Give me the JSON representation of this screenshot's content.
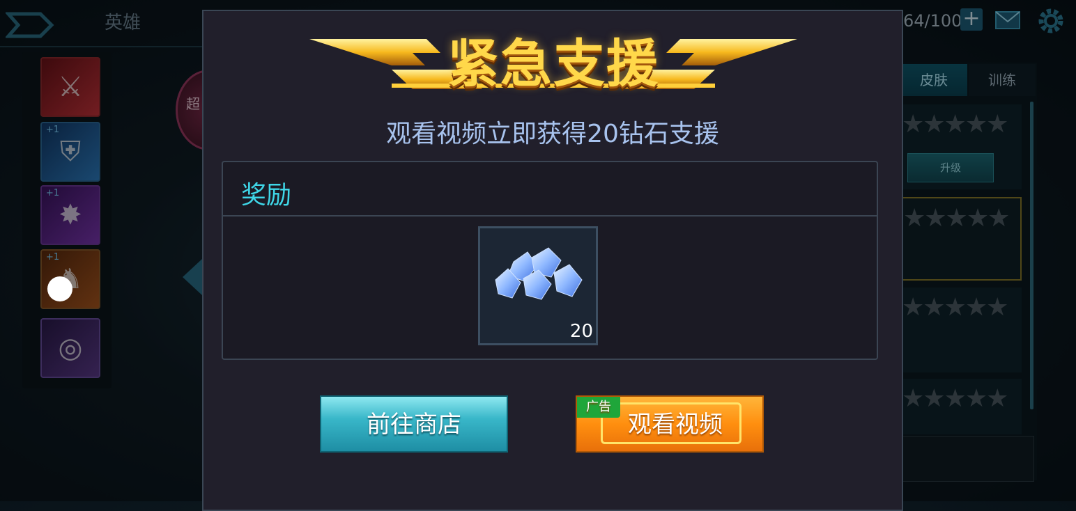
{
  "background": {
    "top_title": "英雄",
    "resource_count": "64/100",
    "add_label": "+",
    "pink_badge_text": "超",
    "equipment_slots": [
      {
        "badge": ""
      },
      {
        "badge": "+1"
      },
      {
        "badge": "+1"
      },
      {
        "badge": "+1"
      },
      {
        "badge": ""
      }
    ],
    "tabs": {
      "skin": "皮肤",
      "train": "训练"
    },
    "upgrade_label": "升级"
  },
  "modal": {
    "title": "紧急支援",
    "subtitle": "观看视频立即获得20钻石支援",
    "reward_header": "奖励",
    "reward_item": {
      "icon": "diamond-icon",
      "quantity": "20"
    },
    "shop_button_label": "前往商店",
    "video_button_label": "观看视频",
    "ad_tag_label": "广告"
  },
  "colors": {
    "title_gold": "#ffd84a",
    "accent_cyan": "#3fd7e8",
    "button_orange": "#ff8f0f",
    "button_cyan": "#39b7c9",
    "ad_green": "#1fa63a"
  }
}
